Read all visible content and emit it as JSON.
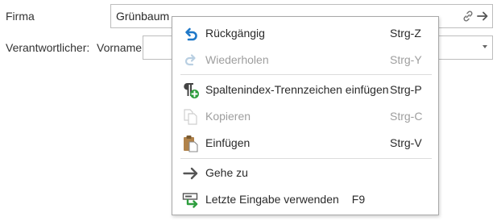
{
  "form": {
    "firma_label": "Firma",
    "firma_value": "Grünbaum",
    "verantwortlicher_label": "Verantwortlicher:",
    "vorname_label": "Vorname",
    "vorname_value": ""
  },
  "context_menu": {
    "items": [
      {
        "label": "Rückgängig",
        "shortcut": "Strg-Z",
        "icon": "undo-icon",
        "enabled": true
      },
      {
        "label": "Wiederholen",
        "shortcut": "Strg-Y",
        "icon": "redo-icon",
        "enabled": false
      },
      {
        "label": "Spaltenindex-Trennzeichen einfügen",
        "shortcut": "Strg-P",
        "icon": "pilcrow-add-icon",
        "enabled": true
      },
      {
        "label": "Kopieren",
        "shortcut": "Strg-C",
        "icon": "copy-icon",
        "enabled": false
      },
      {
        "label": "Einfügen",
        "shortcut": "Strg-V",
        "icon": "paste-icon",
        "enabled": true
      },
      {
        "label": "Gehe zu",
        "shortcut": "",
        "icon": "arrow-right-icon",
        "enabled": true
      },
      {
        "label": "Letzte Eingabe verwenden",
        "shortcut": "F9",
        "icon": "last-input-icon",
        "enabled": true
      }
    ]
  },
  "colors": {
    "undo_blue": "#1f78c8",
    "add_green": "#2e9e3e",
    "paste_brown": "#b0824a",
    "disabled_text": "#9e9e9e",
    "icon_gray": "#555555"
  }
}
